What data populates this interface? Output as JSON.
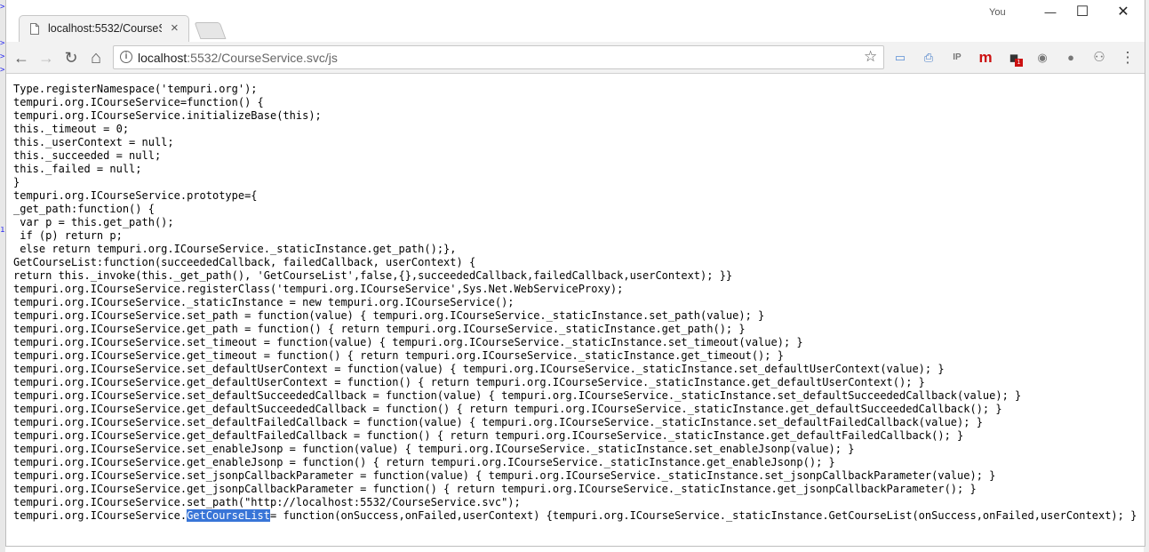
{
  "window": {
    "user_label": "You",
    "minimize_glyph": "—",
    "maximize_glyph": "☐",
    "close_glyph": "✕"
  },
  "tab": {
    "title": "localhost:5532/CourseSe",
    "close_glyph": "×"
  },
  "toolbar": {
    "back_glyph": "←",
    "forward_glyph": "→",
    "reload_glyph": "↻",
    "home_glyph": "⌂",
    "url_host": "localhost",
    "url_path": ":5532/CourseService.svc/js",
    "bookmark_glyph": "☆",
    "menu_glyph": "⋮",
    "extensions": [
      {
        "name": "screen-icon",
        "glyph": "▭"
      },
      {
        "name": "printer-icon",
        "glyph": "⎙"
      },
      {
        "name": "ip-icon",
        "glyph": "IP"
      },
      {
        "name": "m-icon",
        "glyph": "m"
      },
      {
        "name": "puzzle-icon",
        "glyph": "◼",
        "badge": "1"
      },
      {
        "name": "camera-icon",
        "glyph": "◉"
      },
      {
        "name": "bulb-icon",
        "glyph": "●"
      },
      {
        "name": "users-icon",
        "glyph": "⚇"
      }
    ]
  },
  "colors": {
    "accent_red": "#cc1111",
    "selection": "#3875d7"
  },
  "code": {
    "lines": [
      "Type.registerNamespace('tempuri.org');",
      "tempuri.org.ICourseService=function() {",
      "tempuri.org.ICourseService.initializeBase(this);",
      "this._timeout = 0;",
      "this._userContext = null;",
      "this._succeeded = null;",
      "this._failed = null;",
      "}",
      "tempuri.org.ICourseService.prototype={",
      "_get_path:function() {",
      " var p = this.get_path();",
      " if (p) return p;",
      " else return tempuri.org.ICourseService._staticInstance.get_path();},",
      "GetCourseList:function(succeededCallback, failedCallback, userContext) {",
      "return this._invoke(this._get_path(), 'GetCourseList',false,{},succeededCallback,failedCallback,userContext); }}",
      "tempuri.org.ICourseService.registerClass('tempuri.org.ICourseService',Sys.Net.WebServiceProxy);",
      "tempuri.org.ICourseService._staticInstance = new tempuri.org.ICourseService();",
      "tempuri.org.ICourseService.set_path = function(value) { tempuri.org.ICourseService._staticInstance.set_path(value); }",
      "tempuri.org.ICourseService.get_path = function() { return tempuri.org.ICourseService._staticInstance.get_path(); }",
      "tempuri.org.ICourseService.set_timeout = function(value) { tempuri.org.ICourseService._staticInstance.set_timeout(value); }",
      "tempuri.org.ICourseService.get_timeout = function() { return tempuri.org.ICourseService._staticInstance.get_timeout(); }",
      "tempuri.org.ICourseService.set_defaultUserContext = function(value) { tempuri.org.ICourseService._staticInstance.set_defaultUserContext(value); }",
      "tempuri.org.ICourseService.get_defaultUserContext = function() { return tempuri.org.ICourseService._staticInstance.get_defaultUserContext(); }",
      "tempuri.org.ICourseService.set_defaultSucceededCallback = function(value) { tempuri.org.ICourseService._staticInstance.set_defaultSucceededCallback(value); }",
      "tempuri.org.ICourseService.get_defaultSucceededCallback = function() { return tempuri.org.ICourseService._staticInstance.get_defaultSucceededCallback(); }",
      "tempuri.org.ICourseService.set_defaultFailedCallback = function(value) { tempuri.org.ICourseService._staticInstance.set_defaultFailedCallback(value); }",
      "tempuri.org.ICourseService.get_defaultFailedCallback = function() { return tempuri.org.ICourseService._staticInstance.get_defaultFailedCallback(); }",
      "tempuri.org.ICourseService.set_enableJsonp = function(value) { tempuri.org.ICourseService._staticInstance.set_enableJsonp(value); }",
      "tempuri.org.ICourseService.get_enableJsonp = function() { return tempuri.org.ICourseService._staticInstance.get_enableJsonp(); }",
      "tempuri.org.ICourseService.set_jsonpCallbackParameter = function(value) { tempuri.org.ICourseService._staticInstance.set_jsonpCallbackParameter(value); }",
      "tempuri.org.ICourseService.get_jsonpCallbackParameter = function() { return tempuri.org.ICourseService._staticInstance.get_jsonpCallbackParameter(); }",
      "tempuri.org.ICourseService.set_path(\"http://localhost:5532/CourseService.svc\");"
    ],
    "last_line_prefix": "tempuri.org.ICourseService.",
    "last_line_selected": "GetCourseList",
    "last_line_suffix": "= function(onSuccess,onFailed,userContext) {tempuri.org.ICourseService._staticInstance.GetCourseList(onSuccess,onFailed,userContext); }"
  }
}
